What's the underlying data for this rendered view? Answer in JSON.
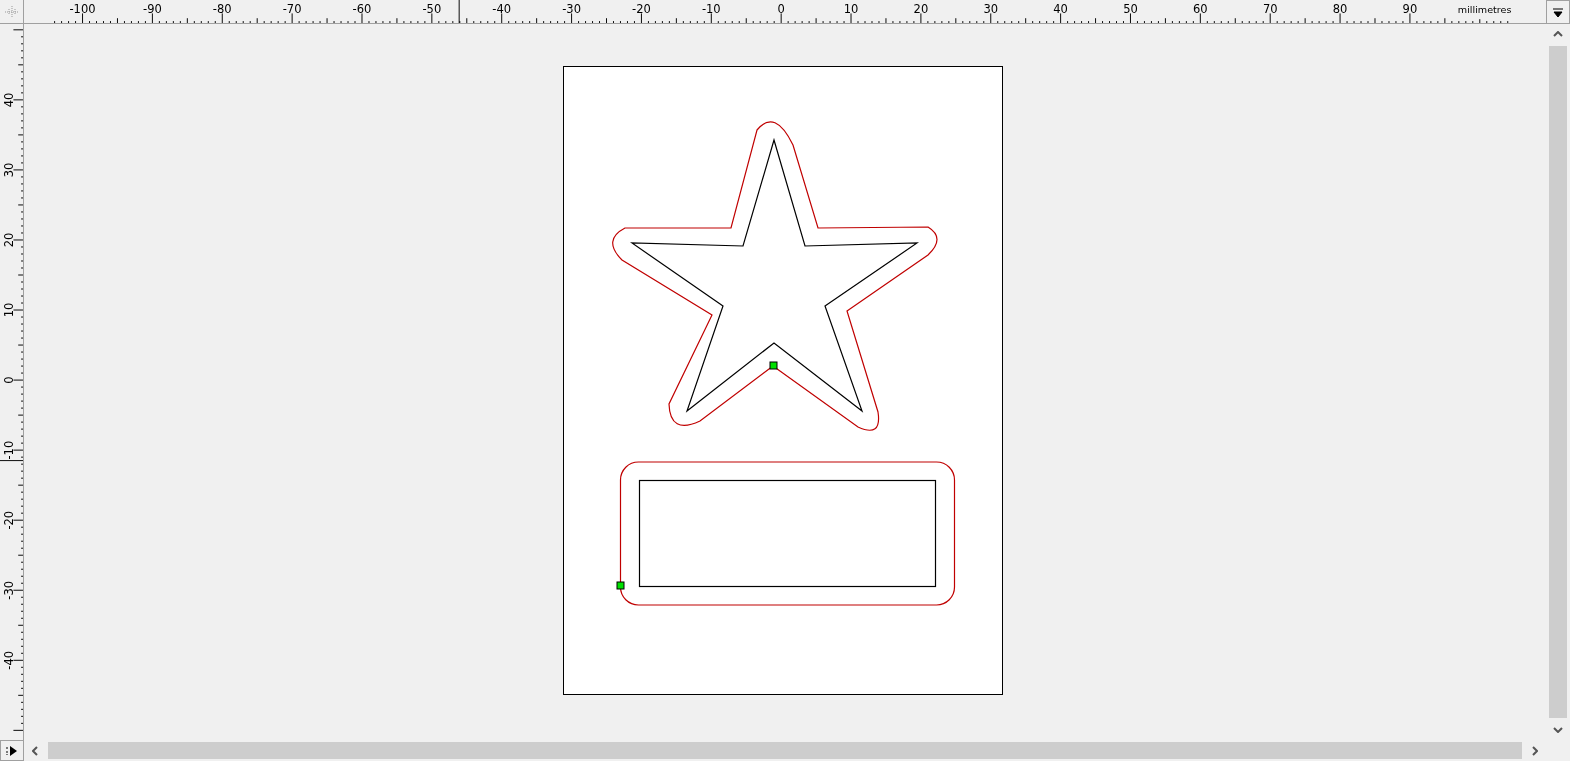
{
  "top_ruler": {
    "labels": [
      "-100",
      "-90",
      "-80",
      "-70",
      "-60",
      "-50",
      "-40",
      "-30",
      "-20",
      "-10",
      "0",
      "10",
      "20",
      "30",
      "40",
      "50",
      "60",
      "70",
      "80",
      "90"
    ],
    "unit": "millimetres"
  },
  "left_ruler": {
    "labels": [
      "40",
      "30",
      "20",
      "10",
      "0",
      "-10",
      "-20",
      "-30",
      "-40"
    ]
  }
}
